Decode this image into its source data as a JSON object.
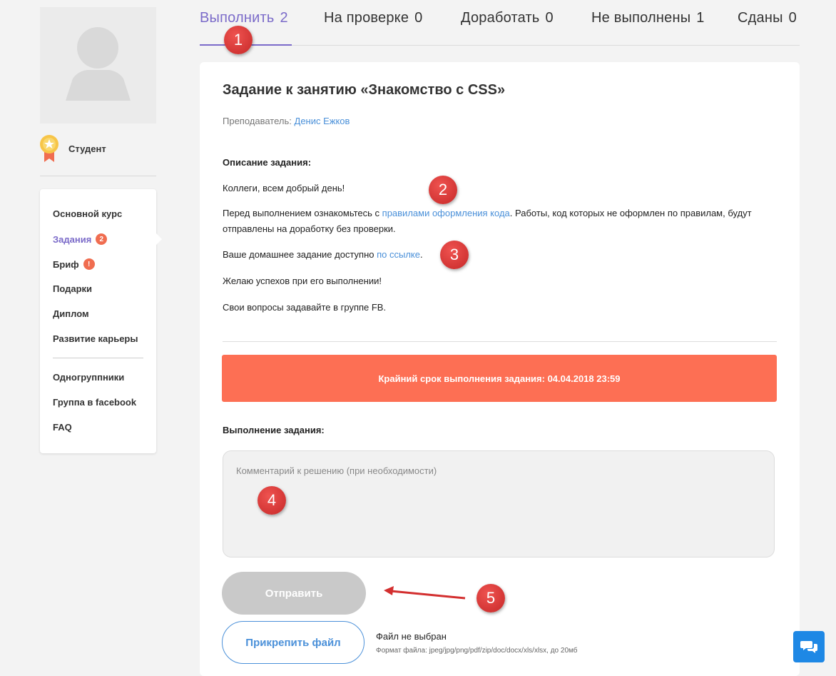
{
  "profile": {
    "role_label": "Студент"
  },
  "sidebar": {
    "items": [
      {
        "label": "Основной курс",
        "active": false
      },
      {
        "label": "Задания",
        "active": true,
        "badge": "2"
      },
      {
        "label": "Бриф",
        "active": false,
        "badge": "!"
      },
      {
        "label": "Подарки",
        "active": false
      },
      {
        "label": "Диплом",
        "active": false
      },
      {
        "label": "Развитие карьеры",
        "active": false
      },
      {
        "label": "Одногруппники",
        "active": false
      },
      {
        "label": "Группа в facebook",
        "active": false
      },
      {
        "label": "FAQ",
        "active": false
      }
    ]
  },
  "tabs": [
    {
      "label": "Выполнить",
      "count": "2",
      "active": true
    },
    {
      "label": "На проверке",
      "count": "0",
      "active": false
    },
    {
      "label": "Доработать",
      "count": "0",
      "active": false
    },
    {
      "label": "Не выполнены",
      "count": "1",
      "active": false
    },
    {
      "label": "Сданы",
      "count": "0",
      "active": false
    }
  ],
  "task": {
    "title": "Задание к занятию «Знакомство с CSS»",
    "teacher_label": "Преподаватель:",
    "teacher_name": "Денис Ежков",
    "description_heading": "Описание задания:",
    "greeting": "Коллеги, всем добрый день!",
    "rules_before": "Перед выполнением ознакомьтесь с",
    "rules_link": "правилами оформления кода",
    "rules_after": ". Работы, код которых не оформлен по правилам, будут отправлены на доработку без проверки.",
    "homework_before": "Ваше домашнее задание доступно",
    "homework_link": "по ссылке",
    "homework_after": ".",
    "wish": "Желаю успехов при его выполнении!",
    "questions": "Свои вопросы задавайте в группе FB.",
    "deadline": "Крайний срок выполнения задания: 04.04.2018 23:59",
    "execution_heading": "Выполнение задания:",
    "comment_placeholder": "Комментарий к решению (при необходимости)",
    "submit_label": "Отправить",
    "attach_label": "Прикрепить файл",
    "file_status": "Файл не выбран",
    "file_format": "Формат файла: jpeg/jpg/png/pdf/zip/doc/docx/xls/xlsx, до 20мб"
  },
  "annotations": [
    "1",
    "2",
    "3",
    "4",
    "5"
  ],
  "colors": {
    "accent": "#7b6bc9",
    "link": "#4a90d9",
    "deadline_bg": "#fd6f54",
    "badge": "#f06d50",
    "annotation": "#d32f2f",
    "chat": "#1e88e5"
  },
  "icons": [
    "avatar-placeholder-icon",
    "medal-icon",
    "chat-icon",
    "annotation-arrow-icon"
  ]
}
